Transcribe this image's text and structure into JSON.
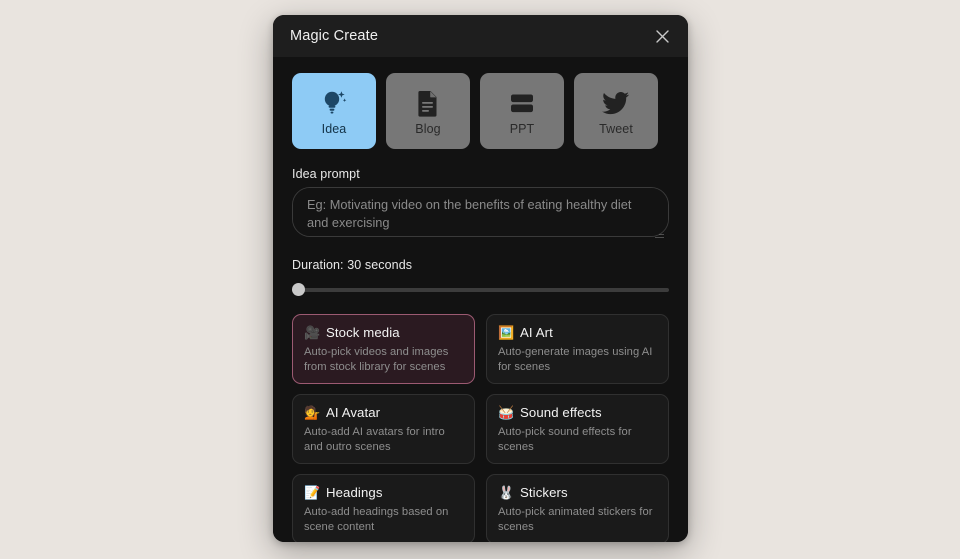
{
  "window": {
    "title": "Magic Create",
    "close_icon": "close-icon"
  },
  "modes": {
    "selected": "Idea",
    "items": [
      {
        "label": "Idea",
        "icon": "lightbulb-sparkle-icon",
        "selected": true
      },
      {
        "label": "Blog",
        "icon": "document-lines-icon",
        "selected": false
      },
      {
        "label": "PPT",
        "icon": "slides-bars-icon",
        "selected": false
      },
      {
        "label": "Tweet",
        "icon": "twitter-bird-icon",
        "selected": false
      }
    ]
  },
  "prompt": {
    "label": "Idea prompt",
    "value": "",
    "placeholder": "Eg: Motivating video on the benefits of eating healthy diet and exercising"
  },
  "duration": {
    "label": "Duration: 30 seconds",
    "value": 30,
    "unit": "seconds",
    "min": 30,
    "max": 300,
    "thumb_percent": 0
  },
  "features": [
    {
      "title": "Stock media",
      "emoji": "🎥",
      "icon": "movie-camera-icon",
      "description": "Auto-pick videos and images from stock library for scenes",
      "selected": true
    },
    {
      "title": "AI Art",
      "emoji": "🖼️",
      "icon": "framed-picture-icon",
      "description": "Auto-generate images using AI for scenes",
      "selected": false
    },
    {
      "title": "AI Avatar",
      "emoji": "💁",
      "icon": "person-tipping-hand-icon",
      "description": "Auto-add AI avatars for intro and outro scenes",
      "selected": false
    },
    {
      "title": "Sound effects",
      "emoji": "🥁",
      "icon": "drum-icon",
      "description": "Auto-pick sound effects for scenes",
      "selected": false
    },
    {
      "title": "Headings",
      "emoji": "📝",
      "icon": "memo-icon",
      "description": "Auto-add headings based on scene content",
      "selected": false
    },
    {
      "title": "Stickers",
      "emoji": "🐰",
      "icon": "rabbit-face-icon",
      "description": "Auto-pick animated stickers for scenes",
      "selected": false
    }
  ],
  "colors": {
    "page_background": "#e9e4df",
    "modal_background": "#121212",
    "header_background": "#1e1e1e",
    "accent_selected_tab": "#8ecbf5",
    "accent_selected_card_border": "#9c5a72",
    "accent_selected_card_bg": "#2b1a21",
    "card_background": "#1a1a1a",
    "card_border": "#303030",
    "text_primary": "#f2f2f2",
    "text_secondary": "#8e8e8e"
  }
}
